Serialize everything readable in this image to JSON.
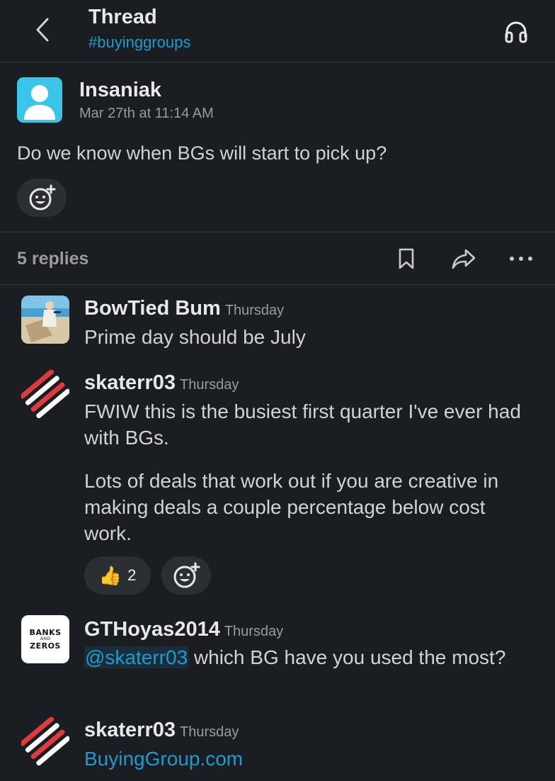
{
  "header": {
    "title": "Thread",
    "channel": "#buyinggroups"
  },
  "parent": {
    "author": "Insaniak",
    "timestamp": "Mar 27th at 11:14 AM",
    "message": "Do we know when BGs will start to pick up?"
  },
  "replies_bar": {
    "count_label": "5 replies"
  },
  "replies": [
    {
      "author": "BowTied Bum",
      "time": "Thursday",
      "text": "Prime day should be July"
    },
    {
      "author": "skaterr03",
      "time": "Thursday",
      "paragraph1": "FWIW this is the busiest first quarter I've ever had with BGs.",
      "paragraph2": "Lots of deals that work out if you are creative in making deals a couple percentage below cost work.",
      "reaction_emoji": "👍",
      "reaction_count": "2"
    },
    {
      "author": "GTHoyas2014",
      "time": "Thursday",
      "mention": "@skaterr03",
      "text": " which BG have you used the most?",
      "avatar_line1": "BANKS",
      "avatar_line2": "AND",
      "avatar_line3": "ZEROS"
    },
    {
      "author": "skaterr03",
      "time": "Thursday",
      "link": "BuyingGroup.com"
    }
  ],
  "colors": {
    "background": "#1a1d21",
    "link": "#1d9bd1",
    "pill": "#2b2e33",
    "divider": "#34363a"
  }
}
